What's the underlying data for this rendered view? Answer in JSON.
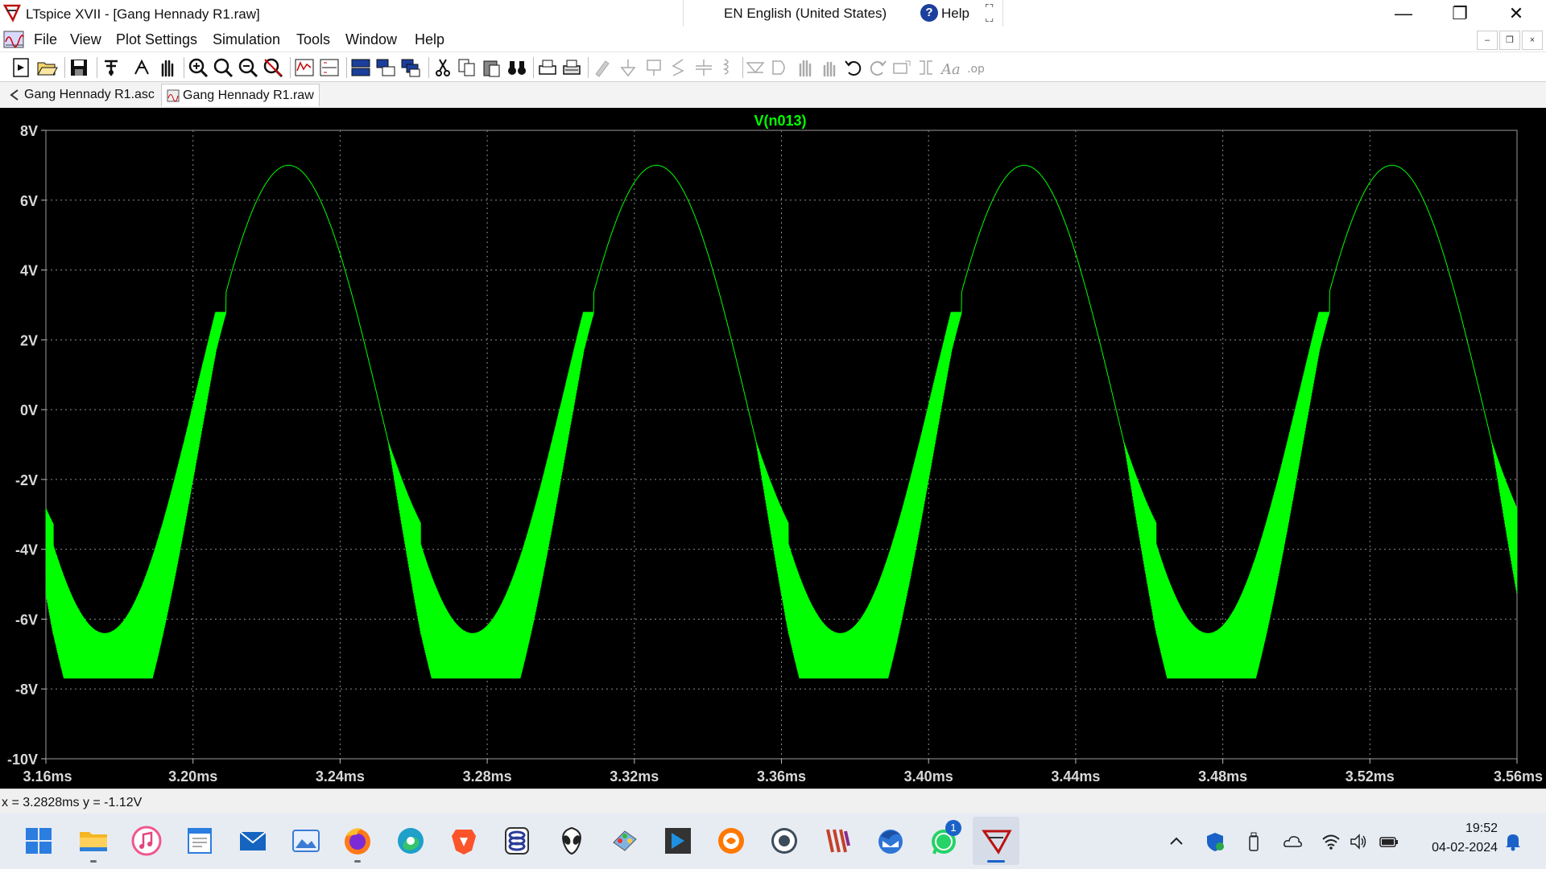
{
  "window": {
    "title": "LTspice XVII - [Gang Hennady R1.raw]",
    "language": "EN English (United States)",
    "help": "Help",
    "minimize": "—",
    "maximize": "❐",
    "close": "✕"
  },
  "menu": [
    "File",
    "View",
    "Plot Settings",
    "Simulation",
    "Tools",
    "Window",
    "Help"
  ],
  "mdi": {
    "minimize": "–",
    "restore": "❐",
    "close": "×"
  },
  "toolbar": [
    "new-schematic",
    "open",
    "save",
    "control-panel",
    "run",
    "halt",
    "zoom-in",
    "zoom-area",
    "zoom-out",
    "zoom-fit",
    "autorange",
    "add-pane",
    "tile-horizontal",
    "tile-vertical",
    "cascade",
    "cut",
    "copy",
    "paste",
    "find",
    "print",
    "print-setup",
    "wire",
    "ground",
    "label",
    "resistor",
    "capacitor",
    "inductor",
    "diode",
    "component",
    "move",
    "drag",
    "undo",
    "redo",
    "rotate",
    "mirror",
    "text",
    "spice-directive"
  ],
  "tabs": [
    {
      "label": "Gang Hennady R1.asc",
      "icon": "schematic-icon"
    },
    {
      "label": "Gang Hennady R1.raw",
      "icon": "waveform-icon"
    }
  ],
  "plot": {
    "trace_label": "V(n013)",
    "trace_color": "#00ff00",
    "background": "#000000"
  },
  "chart_data": {
    "type": "line",
    "title": "",
    "series": [
      {
        "name": "V(n013)"
      }
    ],
    "xlabel": "",
    "ylabel": "",
    "xlim": [
      3.16,
      3.56
    ],
    "ylim": [
      -10,
      8
    ],
    "x_ticks": [
      "3.16ms",
      "3.20ms",
      "3.24ms",
      "3.28ms",
      "3.32ms",
      "3.36ms",
      "3.40ms",
      "3.44ms",
      "3.48ms",
      "3.52ms",
      "3.56ms"
    ],
    "y_ticks": [
      "8V",
      "6V",
      "4V",
      "2V",
      "0V",
      "-2V",
      "-4V",
      "-6V",
      "-8V",
      "-10V"
    ],
    "grid": true,
    "period_ms": 0.1,
    "peak_v": 7.0,
    "peak_times_ms": [
      3.226,
      3.326,
      3.426,
      3.526
    ],
    "trough_envelope_v": [
      -5.0,
      -7.7
    ],
    "ripple_start_v": 2.5
  },
  "status": {
    "text": "x = 3.2828ms    y = -1.12V"
  },
  "taskbar": {
    "apps": [
      "windows-start",
      "file-explorer",
      "itunes",
      "notepad",
      "mail",
      "photos",
      "firefox",
      "edge",
      "brave",
      "app-9",
      "alien-app",
      "paint",
      "vscode-like",
      "avast",
      "steam",
      "winrar",
      "thunderbird",
      "whatsapp",
      "ltspice"
    ],
    "whatsapp_badge": "1",
    "time": "19:52",
    "date": "04-02-2024"
  }
}
